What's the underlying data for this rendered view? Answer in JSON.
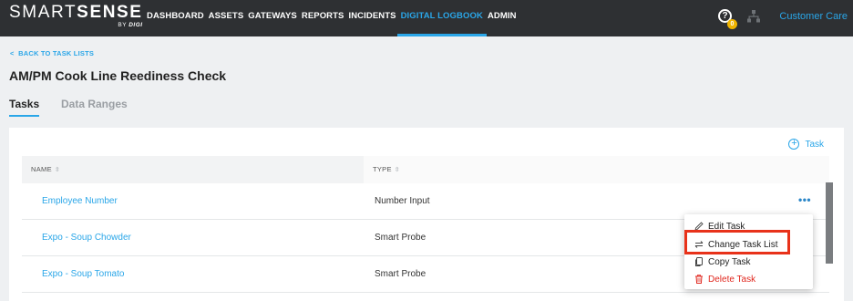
{
  "brand": {
    "name_light": "SMART",
    "name_bold": "SENSE",
    "sub_prefix": "BY ",
    "sub_brand": "DIGI"
  },
  "nav": {
    "items": [
      {
        "label": "DASHBOARD",
        "active": false
      },
      {
        "label": "ASSETS",
        "active": false
      },
      {
        "label": "GATEWAYS",
        "active": false
      },
      {
        "label": "REPORTS",
        "active": false
      },
      {
        "label": "INCIDENTS",
        "active": false
      },
      {
        "label": "DIGITAL LOGBOOK",
        "active": true
      },
      {
        "label": "ADMIN",
        "active": false
      }
    ],
    "help_glyph": "?",
    "help_badge_count": "0",
    "customer_care": "Customer Care"
  },
  "page": {
    "back_link": "BACK TO TASK LISTS",
    "title": "AM/PM Cook Line Reediness Check",
    "tabs": [
      {
        "label": "Tasks",
        "active": true
      },
      {
        "label": "Data Ranges",
        "active": false
      }
    ]
  },
  "table": {
    "add_button_label": "Task",
    "columns": [
      "NAME",
      "TYPE"
    ],
    "rows": [
      {
        "name": "Employee Number",
        "type": "Number Input"
      },
      {
        "name": "Expo - Soup Chowder",
        "type": "Smart Probe"
      },
      {
        "name": "Expo - Soup Tomato",
        "type": "Smart Probe"
      }
    ],
    "row_menu_glyph": "•••"
  },
  "context_menu": {
    "items": [
      {
        "label": "Edit Task",
        "icon": "pencil-icon"
      },
      {
        "label": "Change Task List",
        "icon": "swap-arrows-icon",
        "highlighted": true
      },
      {
        "label": "Copy Task",
        "icon": "copy-icon"
      },
      {
        "label": "Delete Task",
        "icon": "trash-icon",
        "danger": true
      }
    ]
  },
  "colors": {
    "accent": "#2aa6e8",
    "topbar": "#2e3033",
    "danger": "#e0271e",
    "highlight_box": "#e8321a"
  }
}
